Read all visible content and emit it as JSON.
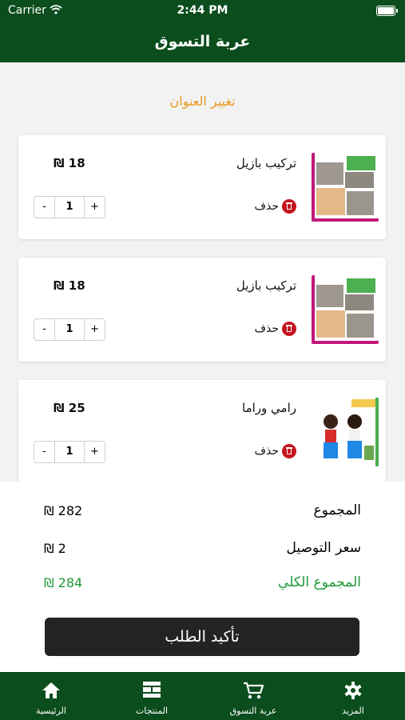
{
  "status_bar": {
    "carrier": "Carrier",
    "time": "2:44 PM"
  },
  "header": {
    "title": "عربة التسوق"
  },
  "change_address": "تغيير العنوان",
  "cart_items": [
    {
      "name": "تركيب بازيل",
      "price": "18 ₪",
      "quantity": "1",
      "delete_label": "حذف",
      "minus": "-",
      "plus": "+"
    },
    {
      "name": "تركيب بازيل",
      "price": "18 ₪",
      "quantity": "1",
      "delete_label": "حذف",
      "minus": "-",
      "plus": "+"
    },
    {
      "name": "رامي وراما",
      "price": "25 ₪",
      "quantity": "1",
      "delete_label": "حذف",
      "minus": "-",
      "plus": "+"
    }
  ],
  "summary": {
    "subtotal_label": "المجموع",
    "subtotal_value": "282 ₪",
    "delivery_label": "سعر التوصيل",
    "delivery_value": "2 ₪",
    "total_label": "المجموع الكلي",
    "total_value": "284 ₪"
  },
  "confirm_label": "تأكيد الطلب",
  "tabs": [
    {
      "label": "الرئيسية",
      "icon": "home-icon"
    },
    {
      "label": "المنتجات",
      "icon": "products-icon"
    },
    {
      "label": "عربة التسوق",
      "icon": "cart-icon"
    },
    {
      "label": "المزيد",
      "icon": "gear-icon"
    }
  ],
  "colors": {
    "brand_green": "#0b4d1c",
    "accent_orange": "#e69a1f",
    "total_green": "#1e9a3a",
    "delete_red": "#c4141e"
  }
}
